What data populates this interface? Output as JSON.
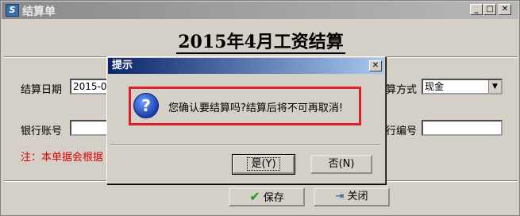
{
  "window": {
    "title": "结算单"
  },
  "heading": "2015年4月工资结算",
  "form": {
    "settle_date_label": "结算日期",
    "settle_date_value": "2015-05",
    "pay_method_label_partial": "算方式",
    "pay_method_value": "现金",
    "bank_account_label": "银行账号",
    "bank_account_value": "",
    "code_label_partial": "行编号",
    "code_value": "",
    "note_partial": "注：本单据会根据"
  },
  "bottom_buttons": {
    "save_label": "保存",
    "close_label": "关闭"
  },
  "dialog": {
    "title": "提示",
    "message": "您确认要结算吗?结算后将不可再取消!",
    "yes_label": "是(Y)",
    "no_label": "否(N)"
  },
  "colors": {
    "highlight_border": "#e0202a",
    "note_text": "#e00000",
    "dialog_title": "#0a246a"
  },
  "icons": [
    "app-icon",
    "question-icon",
    "checkmark-icon",
    "exit-door-icon"
  ]
}
